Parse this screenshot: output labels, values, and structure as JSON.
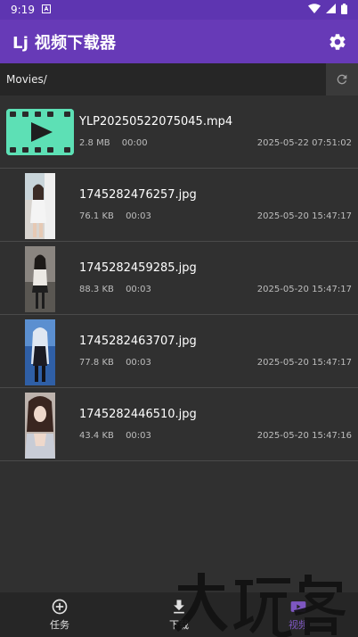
{
  "status": {
    "time": "9:19"
  },
  "app": {
    "title": "Lj 视频下载器"
  },
  "path": {
    "text": "Movies/"
  },
  "files": [
    {
      "name": "YLP20250522075045.mp4",
      "size": "2.8 MB",
      "duration": "00:00",
      "date": "2025-05-22 07:51:02",
      "kind": "video"
    },
    {
      "name": "1745282476257.jpg",
      "size": "76.1 KB",
      "duration": "00:03",
      "date": "2025-05-20 15:47:17",
      "kind": "image"
    },
    {
      "name": "1745282459285.jpg",
      "size": "88.3 KB",
      "duration": "00:03",
      "date": "2025-05-20 15:47:17",
      "kind": "image"
    },
    {
      "name": "1745282463707.jpg",
      "size": "77.8 KB",
      "duration": "00:03",
      "date": "2025-05-20 15:47:17",
      "kind": "image"
    },
    {
      "name": "1745282446510.jpg",
      "size": "43.4 KB",
      "duration": "00:03",
      "date": "2025-05-20 15:47:16",
      "kind": "image"
    }
  ],
  "nav": [
    {
      "label": "任务",
      "icon": "add-circle-icon",
      "active": false
    },
    {
      "label": "下载",
      "icon": "download-icon",
      "active": false
    },
    {
      "label": "视频",
      "icon": "video-icon",
      "active": true
    }
  ],
  "watermark": {
    "text": "大玩客"
  },
  "colors": {
    "primary": "#673ab7",
    "status_bar": "#5e35b1",
    "video_thumb": "#5de0b5",
    "active_nav": "#7e57c2"
  }
}
